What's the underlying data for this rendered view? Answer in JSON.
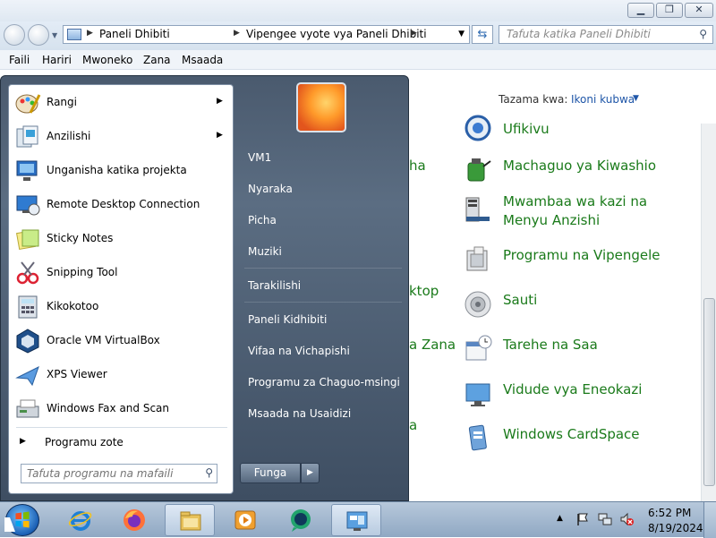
{
  "window": {
    "breadcrumb": [
      "Paneli Dhibiti",
      "Vipengee vyote vya Paneli Dhibiti"
    ],
    "search_placeholder": "Tafuta katika Paneli Dhibiti",
    "menu": [
      "Faili",
      "Hariri",
      "Mwoneko",
      "Zana",
      "Msaada"
    ],
    "view_by_label": "Tazama kwa:",
    "view_by_value": "Ikoni kubwa"
  },
  "control_panel_items": [
    {
      "label": "Ufikivu",
      "icon": "ease-of-access-icon"
    },
    {
      "label": "Machaguo ya Kiwashio",
      "icon": "power-options-icon"
    },
    {
      "label": "Mwambaa wa kazi na",
      "label2": "Menyu Anzishi",
      "icon": "taskbar-start-menu-icon"
    },
    {
      "label": "Programu na Vipengele",
      "icon": "programs-features-icon"
    },
    {
      "label": "Sauti",
      "icon": "sound-icon"
    },
    {
      "label": "Tarehe na Saa",
      "icon": "date-time-icon"
    },
    {
      "label": "Vidude vya Eneokazi",
      "icon": "desktop-gadgets-icon"
    },
    {
      "label": "Windows CardSpace",
      "icon": "cardspace-icon"
    }
  ],
  "left_column_fragments": [
    "ha",
    "ktop",
    "a Zana",
    "a"
  ],
  "start_menu": {
    "programs": [
      {
        "label": "Rangi",
        "icon": "paint-icon",
        "submenu": true
      },
      {
        "label": "Anzilishi",
        "icon": "getting-started-icon",
        "submenu": true
      },
      {
        "label": "Unganisha katika projekta",
        "icon": "projector-icon",
        "submenu": false
      },
      {
        "label": "Remote Desktop Connection",
        "icon": "remote-desktop-icon",
        "submenu": false
      },
      {
        "label": "Sticky Notes",
        "icon": "sticky-notes-icon",
        "submenu": false
      },
      {
        "label": "Snipping Tool",
        "icon": "snipping-tool-icon",
        "submenu": false
      },
      {
        "label": "Kikokotoo",
        "icon": "calculator-icon",
        "submenu": false
      },
      {
        "label": "Oracle VM VirtualBox",
        "icon": "virtualbox-icon",
        "submenu": false
      },
      {
        "label": "XPS Viewer",
        "icon": "xps-viewer-icon",
        "submenu": false
      },
      {
        "label": "Windows Fax and Scan",
        "icon": "fax-scan-icon",
        "submenu": false
      }
    ],
    "all_programs": "Programu zote",
    "search_placeholder": "Tafuta programu na mafaili",
    "places": [
      "VM1",
      "Nyaraka",
      "Picha",
      "Muziki",
      "Tarakilishi",
      "Paneli Kidhibiti",
      "Vifaa na Vichapishi",
      "Programu za Chaguo-msingi",
      "Msaada na Usaidizi"
    ],
    "shutdown_label": "Funga"
  },
  "taskbar": {
    "time": "6:52 PM",
    "date": "8/19/2024"
  }
}
